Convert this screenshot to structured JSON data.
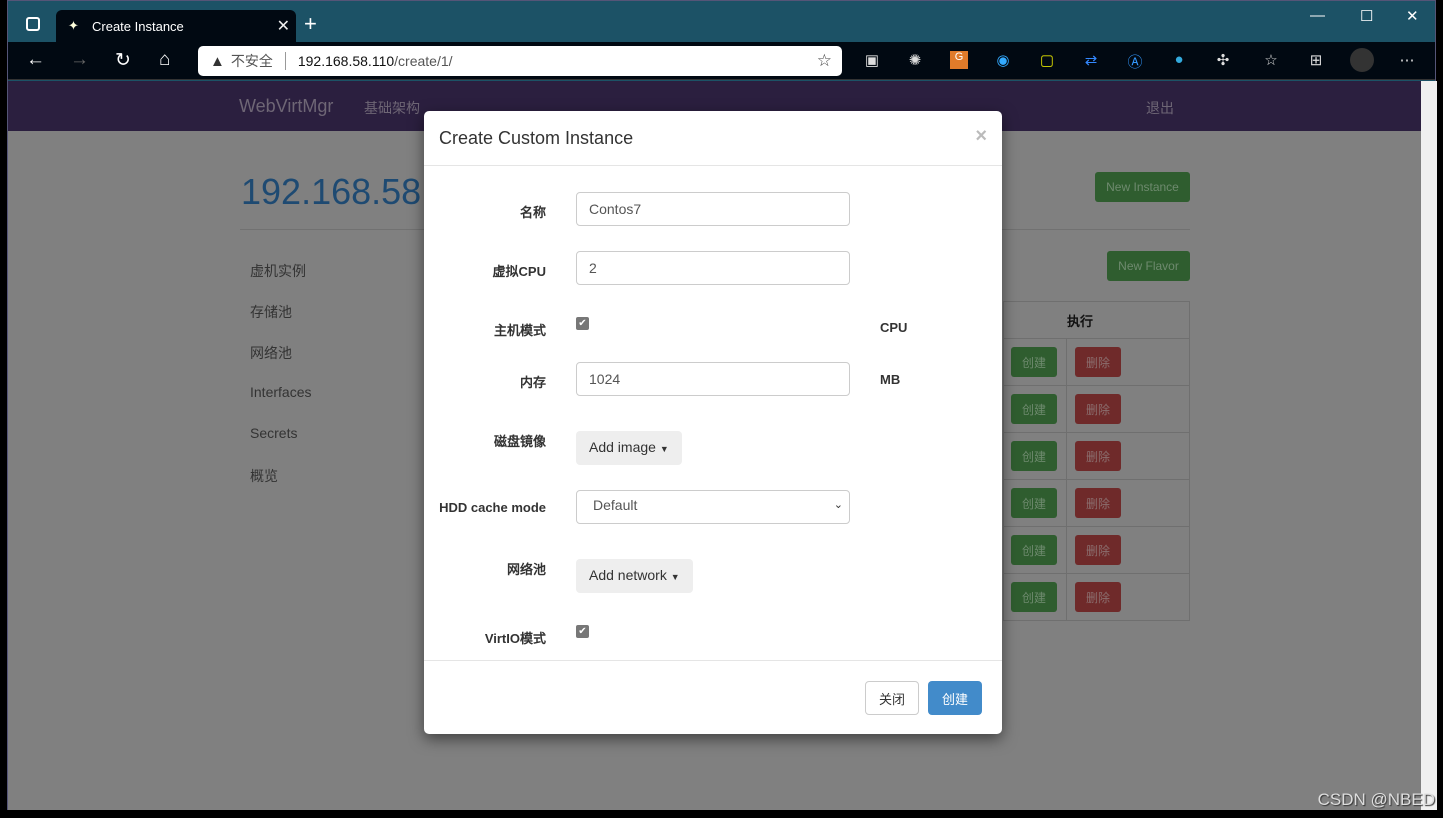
{
  "browser": {
    "tab_title": "Create Instance",
    "url_warning": "不安全",
    "url_host": "192.168.58.110",
    "url_path": "/create/1/"
  },
  "navbar": {
    "brand": "WebVirtMgr",
    "infrastructure": "基础架构",
    "logout": "退出"
  },
  "background": {
    "title": "192.168.58.",
    "sidebar": [
      "虚机实例",
      "存储池",
      "网络池",
      "Interfaces",
      "Secrets",
      "概览"
    ],
    "new_instance": "New Instance",
    "new_flavor": "New Flavor",
    "table_header": "执行",
    "row_create": "创建",
    "row_delete": "删除",
    "rows": 6
  },
  "modal": {
    "title": "Create Custom Instance",
    "close": "×",
    "fields": {
      "name_label": "名称",
      "name_value": "Contos7",
      "vcpu_label": "虚拟CPU",
      "vcpu_value": "2",
      "host_model_label": "主机模式",
      "host_model_checked": true,
      "host_model_unit": "CPU",
      "memory_label": "内存",
      "memory_value": "1024",
      "memory_unit": "MB",
      "disk_label": "磁盘镜像",
      "disk_button": "Add image",
      "cache_label": "HDD cache mode",
      "cache_value": "Default",
      "network_label": "网络池",
      "network_button": "Add network",
      "virtio_label": "VirtIO模式",
      "virtio_checked": true
    },
    "footer": {
      "close": "关闭",
      "create": "创建"
    }
  },
  "watermark": "CSDN @NBED",
  "colors": {
    "primary": "#428bca",
    "success": "#5cb85c",
    "danger": "#d9534f",
    "navbar": "#2b1f3f"
  }
}
